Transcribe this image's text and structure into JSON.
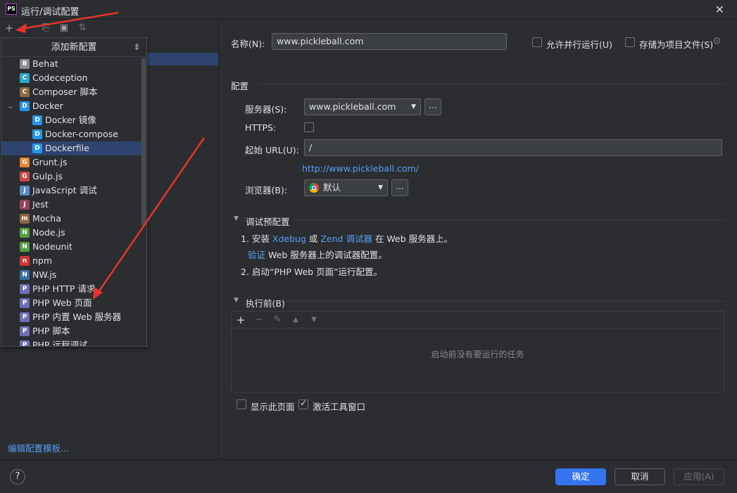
{
  "window": {
    "title": "运行/调试配置",
    "logo_text": "PS"
  },
  "toolbar": {
    "add": "+",
    "copy": "⎘",
    "folder": "▣",
    "sort": "⇅"
  },
  "popup": {
    "header": "添加新配置",
    "items": [
      {
        "label": "Behat",
        "icon": "behat-icon",
        "color": "#8a8d93",
        "glyph": "B"
      },
      {
        "label": "Codeception",
        "icon": "codeception-icon",
        "color": "#2aa7c9",
        "glyph": "C"
      },
      {
        "label": "Composer 脚本",
        "icon": "composer-icon",
        "color": "#8b6a3e",
        "glyph": "C"
      },
      {
        "label": "Docker",
        "icon": "docker-icon",
        "color": "#2496ed",
        "glyph": "D"
      },
      {
        "label": "Docker 镜像",
        "icon": "docker-icon",
        "color": "#2496ed",
        "glyph": "D"
      },
      {
        "label": "Docker-compose",
        "icon": "docker-icon",
        "color": "#2496ed",
        "glyph": "D"
      },
      {
        "label": "Dockerfile",
        "icon": "docker-icon",
        "color": "#2496ed",
        "glyph": "D"
      },
      {
        "label": "Grunt.js",
        "icon": "grunt-icon",
        "color": "#e48632",
        "glyph": "G"
      },
      {
        "label": "Gulp.js",
        "icon": "gulp-icon",
        "color": "#cf4646",
        "glyph": "G"
      },
      {
        "label": "JavaScript 调试",
        "icon": "javascript-debug-icon",
        "color": "#5b8bc9",
        "glyph": "J"
      },
      {
        "label": "Jest",
        "icon": "jest-icon",
        "color": "#99425b",
        "glyph": "J"
      },
      {
        "label": "Mocha",
        "icon": "mocha-icon",
        "color": "#8d6748",
        "glyph": "m"
      },
      {
        "label": "Node.js",
        "icon": "nodejs-icon",
        "color": "#539e43",
        "glyph": "N"
      },
      {
        "label": "Nodeunit",
        "icon": "nodeunit-icon",
        "color": "#539e43",
        "glyph": "N"
      },
      {
        "label": "npm",
        "icon": "npm-icon",
        "color": "#cb3837",
        "glyph": "n"
      },
      {
        "label": "NW.js",
        "icon": "nwjs-icon",
        "color": "#3a6ea5",
        "glyph": "N"
      },
      {
        "label": "PHP HTTP 请求",
        "icon": "php-icon",
        "color": "#6c6fb4",
        "glyph": "P"
      },
      {
        "label": "PHP Web 页面",
        "icon": "php-icon",
        "color": "#6c6fb4",
        "glyph": "P"
      },
      {
        "label": "PHP 内置 Web 服务器",
        "icon": "php-icon",
        "color": "#6c6fb4",
        "glyph": "P"
      },
      {
        "label": "PHP 脚本",
        "icon": "php-icon",
        "color": "#6c6fb4",
        "glyph": "P"
      },
      {
        "label": "PHP 远程调试",
        "icon": "php-icon",
        "color": "#6c6fb4",
        "glyph": "P"
      }
    ]
  },
  "left": {
    "edit_templates": "编辑配置模板..."
  },
  "form": {
    "name_label": "名称(N):",
    "name_value": "www.pickleball.com",
    "parallel_label": "允许并行运行(U)",
    "store_label": "存储为项目文件(S)",
    "config_section": "配置",
    "server_label": "服务器(S):",
    "server_value": "www.pickleball.com",
    "more_btn": "...",
    "https_label": "HTTPS:",
    "start_url_label": "起始 URL(U):",
    "start_url_value": "/",
    "resolved_url": "http://www.pickleball.com/",
    "browser_label": "浏览器(B):",
    "browser_value": "默认",
    "debug_section": "调试预配置",
    "step1_prefix": "1. 安装",
    "xdebug": "Xdebug",
    "or": "或",
    "zend": "Zend 调试器",
    "step1_suffix": "在 Web 服务器上。",
    "verify": "验证",
    "verify_suffix": "Web 服务器上的调试器配置。",
    "step2": "2. 启动“PHP Web 页面”运行配置。",
    "before_section": "执行前(B)",
    "tasks_empty": "启动前没有要运行的任务",
    "show_page_label": "显示此页面",
    "activate_tool_label": "激活工具窗口"
  },
  "buttons": {
    "ok": "确定",
    "cancel": "取消",
    "apply": "应用(A)",
    "help": "?"
  },
  "colors": {
    "accent": "#3574f0",
    "link": "#589df6",
    "arrow": "#e8322b"
  }
}
